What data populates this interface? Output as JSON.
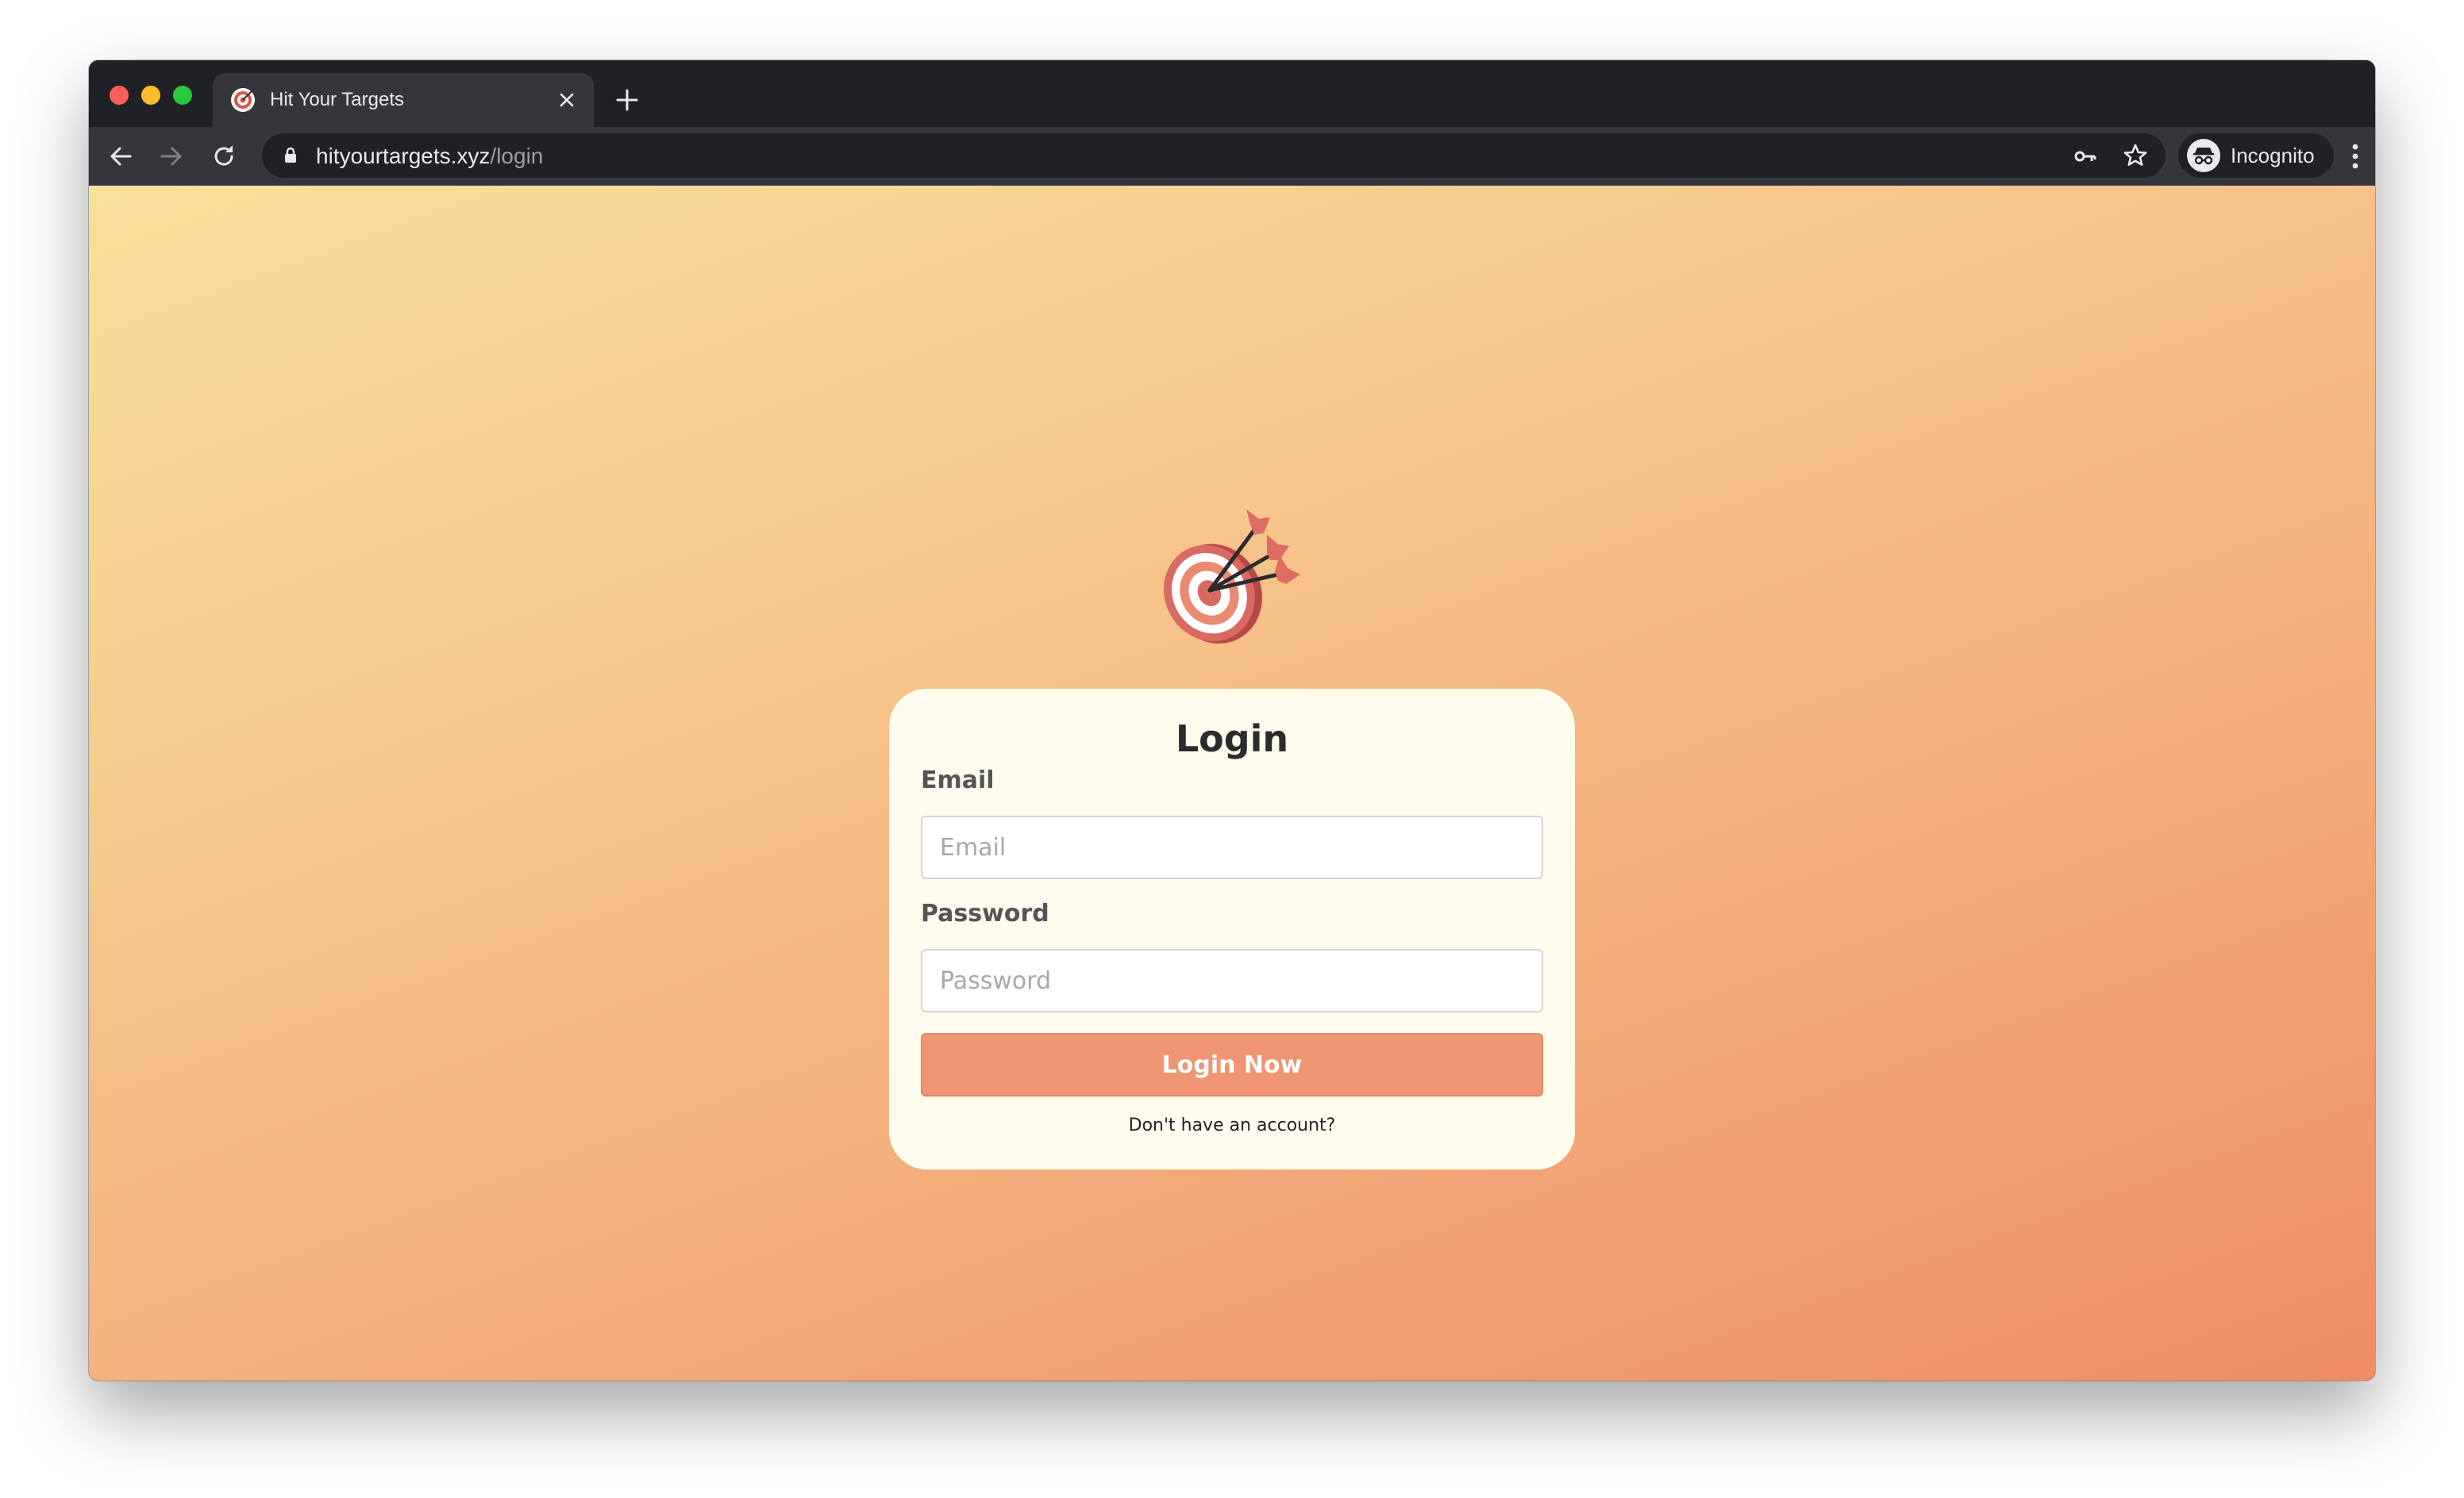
{
  "browser": {
    "tab": {
      "title": "Hit Your Targets",
      "favicon": "target-icon"
    },
    "address_bar": {
      "domain": "hityourtargets.xyz",
      "path": "/login"
    },
    "profile_label": "Incognito",
    "icons": {
      "back": "arrow-left-icon",
      "forward": "arrow-right-icon",
      "reload": "reload-icon",
      "lock": "lock-icon",
      "key": "key-icon",
      "bookmark": "star-icon",
      "menu": "kebab-menu-icon",
      "new_tab": "plus-icon",
      "close_tab": "close-icon"
    }
  },
  "page": {
    "logo": "target-with-arrows-icon",
    "title": "Login",
    "email": {
      "label": "Email",
      "placeholder": "Email",
      "value": ""
    },
    "password": {
      "label": "Password",
      "placeholder": "Password",
      "value": ""
    },
    "submit_label": "Login Now",
    "signup_link": "Don't have an account?"
  },
  "colors": {
    "gradient_start": "#f9e09c",
    "gradient_end": "#ef8c6a",
    "card_background": "#fffcee",
    "button_background": "#ef9672",
    "browser_chrome": "#202124",
    "toolbar": "#35363a"
  }
}
